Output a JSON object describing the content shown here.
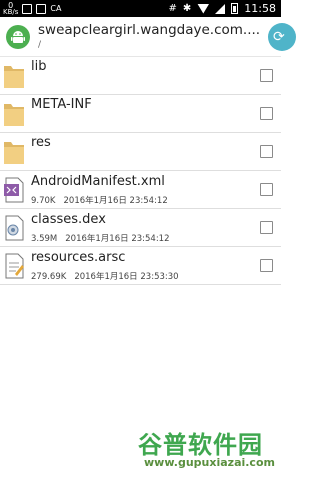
{
  "statusbar": {
    "net_value": "0",
    "net_unit": "KB/s",
    "carrier": "CA",
    "time": "11:58",
    "hash_symbol": "#",
    "bt_symbol": "✱"
  },
  "appbar": {
    "title": "sweapcleargirl.wangdaye.com....",
    "subtitle": "/",
    "app_icon": "android-icon",
    "action_icon": "refresh-icon",
    "accent": "#4fb4c9"
  },
  "files": [
    {
      "name": "lib",
      "type": "folder",
      "icon": "folder-icon"
    },
    {
      "name": "META-INF",
      "type": "folder",
      "icon": "folder-icon"
    },
    {
      "name": "res",
      "type": "folder",
      "icon": "folder-icon"
    },
    {
      "name": "AndroidManifest.xml",
      "type": "file",
      "size": "9.70K",
      "date": "2016年1月16日 23:54:12",
      "icon": "xml-file-icon"
    },
    {
      "name": "classes.dex",
      "type": "file",
      "size": "3.59M",
      "date": "2016年1月16日 23:54:12",
      "icon": "dex-file-icon"
    },
    {
      "name": "resources.arsc",
      "type": "file",
      "size": "279.69K",
      "date": "2016年1月16日 23:53:30",
      "icon": "arsc-file-icon"
    }
  ],
  "watermark": {
    "title": "谷普软件园",
    "url": "www.gupuxiazai.com"
  }
}
